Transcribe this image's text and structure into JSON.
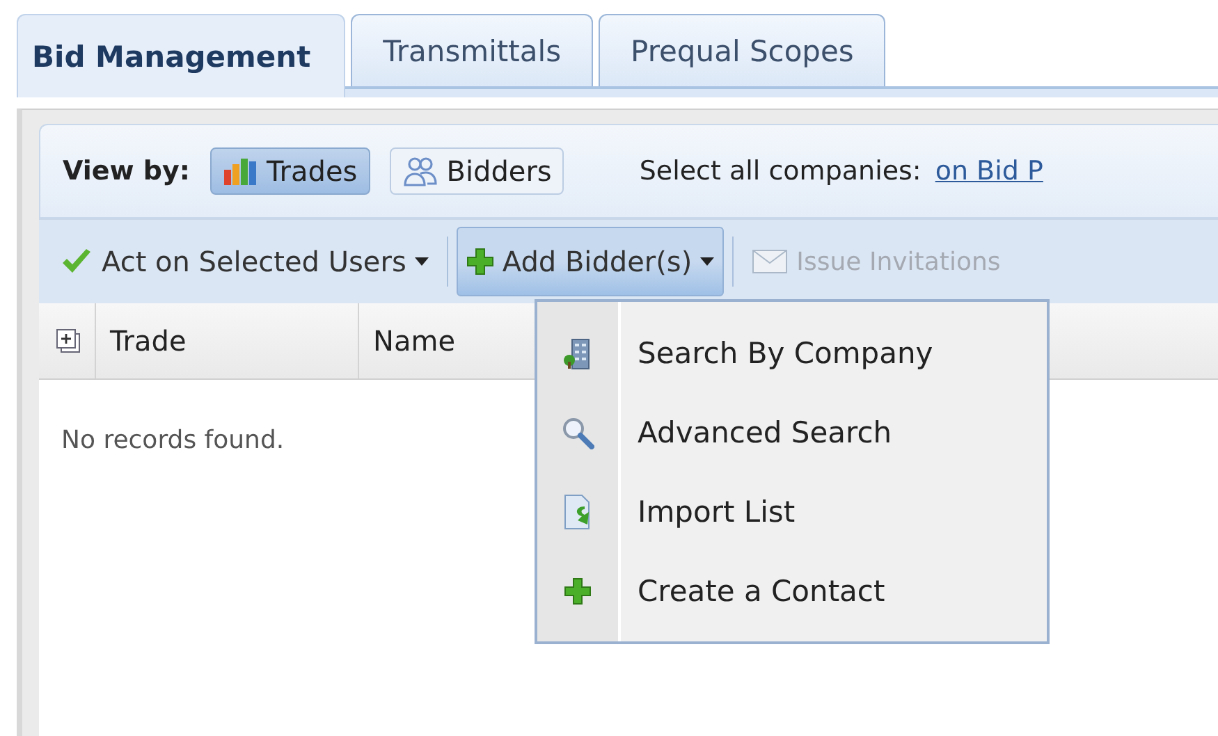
{
  "tabs": [
    {
      "label": "Bid Management",
      "selected": true
    },
    {
      "label": "Transmittals",
      "selected": false
    },
    {
      "label": "Prequal Scopes",
      "selected": false
    }
  ],
  "view_by": {
    "label": "View by:",
    "options": [
      {
        "label": "Trades",
        "kind": "chart",
        "selected": true
      },
      {
        "label": "Bidders",
        "kind": "people",
        "selected": false
      }
    ]
  },
  "select_all": {
    "label": "Select all companies:",
    "link": "on Bid P"
  },
  "toolbar": [
    {
      "label": "Act on Selected Users",
      "kind": "checkmark",
      "has_menu": true,
      "expanded": false,
      "disabled": false
    },
    {
      "label": "Add Bidder(s)",
      "kind": "plus",
      "has_menu": true,
      "expanded": true,
      "disabled": false
    },
    {
      "label": "Issue Invitations",
      "kind": "envelope",
      "has_menu": false,
      "expanded": false,
      "disabled": true
    }
  ],
  "grid": {
    "columns": [
      "Trade",
      "Name"
    ],
    "empty_text": "No records found."
  },
  "menu": {
    "items": [
      {
        "label": "Search By Company",
        "kind": "building"
      },
      {
        "label": "Advanced Search",
        "kind": "magnifier"
      },
      {
        "label": "Import List",
        "kind": "document"
      },
      {
        "label": "Create a Contact",
        "kind": "plus"
      }
    ]
  }
}
